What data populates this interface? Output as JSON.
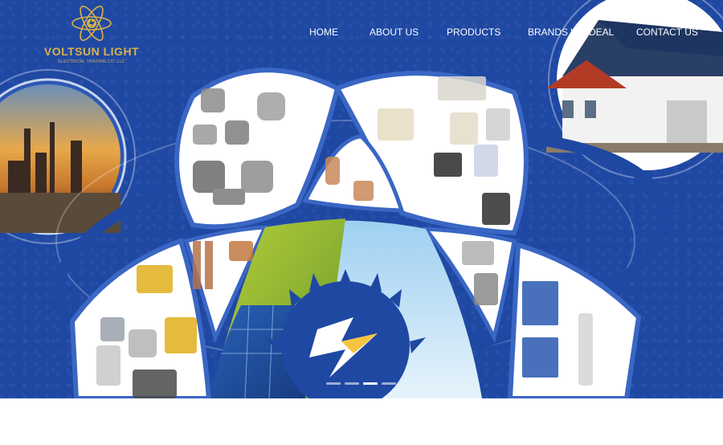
{
  "brand": {
    "name": "VOLTSUN LIGHT",
    "tagline": "ELECTRICAL TRADING CO. LLC"
  },
  "nav": {
    "items": [
      {
        "label": "HOME"
      },
      {
        "label": "ABOUT US"
      },
      {
        "label": "PRODUCTS"
      },
      {
        "label": "BRANDS WE DEAL"
      },
      {
        "label": "CONTACT US"
      }
    ]
  },
  "slider": {
    "slide_count": 4,
    "active_index": 2
  },
  "colors": {
    "background_blue": "#1f48a3",
    "accent_gold": "#d8b24a",
    "nav_text": "#ffffff"
  },
  "icons": [
    "atom-logo-icon",
    "lightning-bolt-icon",
    "sun-icon"
  ]
}
